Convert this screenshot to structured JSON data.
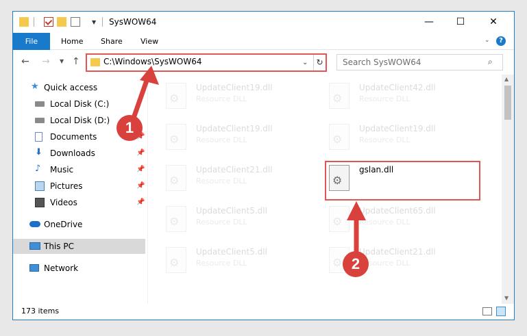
{
  "window": {
    "title": "SysWOW64",
    "minimize": "—",
    "maximize": "☐",
    "close": "✕"
  },
  "ribbon": {
    "file": "File",
    "tabs": [
      "Home",
      "Share",
      "View"
    ],
    "help": "?"
  },
  "nav": {
    "address": "C:\\Windows\\SysWOW64",
    "search_placeholder": "Search SysWOW64"
  },
  "sidebar": {
    "items": [
      {
        "label": "Quick access",
        "icon": "star-icon",
        "pinned": false
      },
      {
        "label": "Local Disk (C:)",
        "icon": "drive-icon",
        "pinned": false
      },
      {
        "label": "Local Disk (D:)",
        "icon": "drive-icon",
        "pinned": false
      },
      {
        "label": "Documents",
        "icon": "documents-icon",
        "pinned": true
      },
      {
        "label": "Downloads",
        "icon": "download-icon",
        "pinned": true
      },
      {
        "label": "Music",
        "icon": "music-icon",
        "pinned": true
      },
      {
        "label": "Pictures",
        "icon": "pictures-icon",
        "pinned": true
      },
      {
        "label": "Videos",
        "icon": "videos-icon",
        "pinned": true
      },
      {
        "label": "OneDrive",
        "icon": "cloud-icon",
        "pinned": false
      },
      {
        "label": "This PC",
        "icon": "computer-icon",
        "pinned": false
      },
      {
        "label": "Network",
        "icon": "network-icon",
        "pinned": false
      }
    ]
  },
  "files": [
    {
      "name": "UpdateClient19.dll",
      "type": "Resource DLL"
    },
    {
      "name": "UpdateClient42.dll",
      "type": "Resource DLL"
    },
    {
      "name": "UpdateClient19.dll",
      "type": "Resource DLL"
    },
    {
      "name": "UpdateClient19.dll",
      "type": "Resource DLL"
    },
    {
      "name": "UpdateClient21.dll",
      "type": "Resource DLL"
    },
    {
      "name": "gslan.dll",
      "type": ""
    },
    {
      "name": "UpdateClient5.dll",
      "type": "Resource DLL"
    },
    {
      "name": "UpdateClient65.dll",
      "type": "Resource DLL"
    },
    {
      "name": "UpdateClient5.dll",
      "type": "Resource DLL"
    },
    {
      "name": "UpdateClient21.dll",
      "type": "Resource DLL"
    }
  ],
  "status": {
    "count": "173 items"
  },
  "callouts": [
    "1",
    "2"
  ],
  "colors": {
    "accent": "#1979ca",
    "highlight": "#e25555",
    "callout": "#d9423c"
  }
}
